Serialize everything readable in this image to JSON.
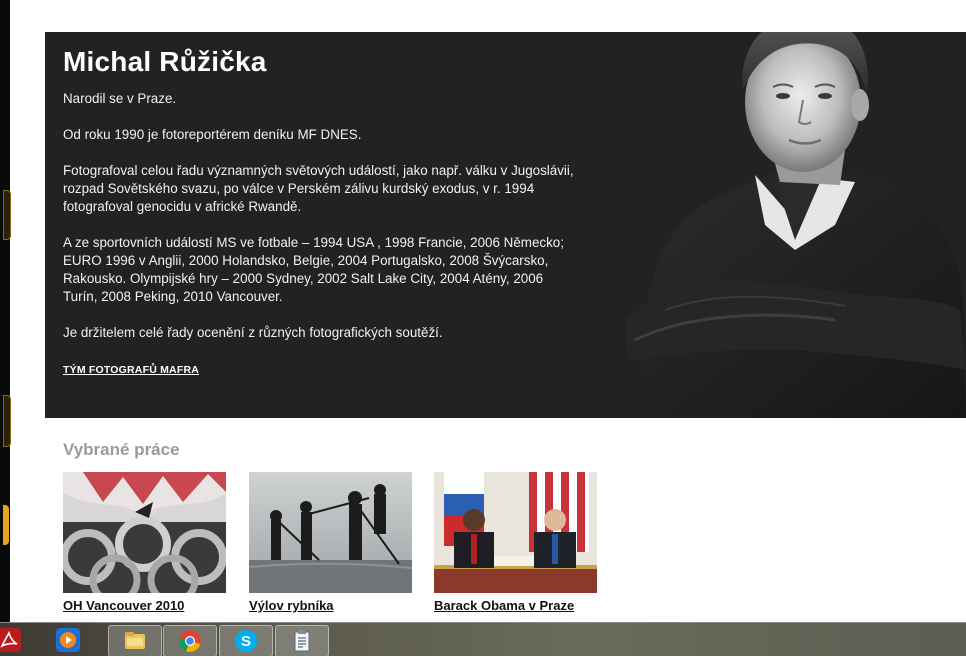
{
  "bio": {
    "name": "Michal Růžička",
    "paragraphs": [
      "Narodil se v Praze.",
      "Od roku 1990 je fotoreportérem deníku MF DNES.",
      "Fotografoval celou řadu významných světových událostí, jako např. válku v Jugoslávii, rozpad Sovětského svazu, po válce v Perském zálivu kurdský exodus, v r. 1994 fotografoval genocidu v africké Rwandě.",
      "A ze sportovních událostí MS ve fotbale – 1994 USA , 1998 Francie, 2006 Německo; EURO 1996 v Anglii, 2000 Holandsko, Belgie, 2004 Portugalsko, 2008 Švýcarsko, Rakousko. Olympijské hry – 2000 Sydney, 2002 Salt Lake City, 2004 Atény, 2006 Turín, 2008 Peking, 2010 Vancouver.",
      "Je držitelem celé řady ocenění z různých fotografických soutěží."
    ],
    "team_link": "TÝM FOTOGRAFŮ MAFRA"
  },
  "works": {
    "title": "Vybrané práce",
    "items": [
      {
        "caption": "OH Vancouver 2010"
      },
      {
        "caption": "Výlov rybníka"
      },
      {
        "caption": "Barack Obama v Praze"
      }
    ]
  },
  "taskbar": {
    "icons": [
      "acrobat-icon",
      "media-player-icon",
      "file-explorer-icon",
      "chrome-icon",
      "skype-icon",
      "notepad-icon"
    ]
  },
  "colors": {
    "panel_bg": "#232123",
    "works_title": "#9a9a9a",
    "chrome_red": "#db4437",
    "chrome_green": "#0f9d58",
    "chrome_yellow": "#f4b400",
    "chrome_blue": "#4285f4",
    "skype_blue": "#00aff0"
  }
}
